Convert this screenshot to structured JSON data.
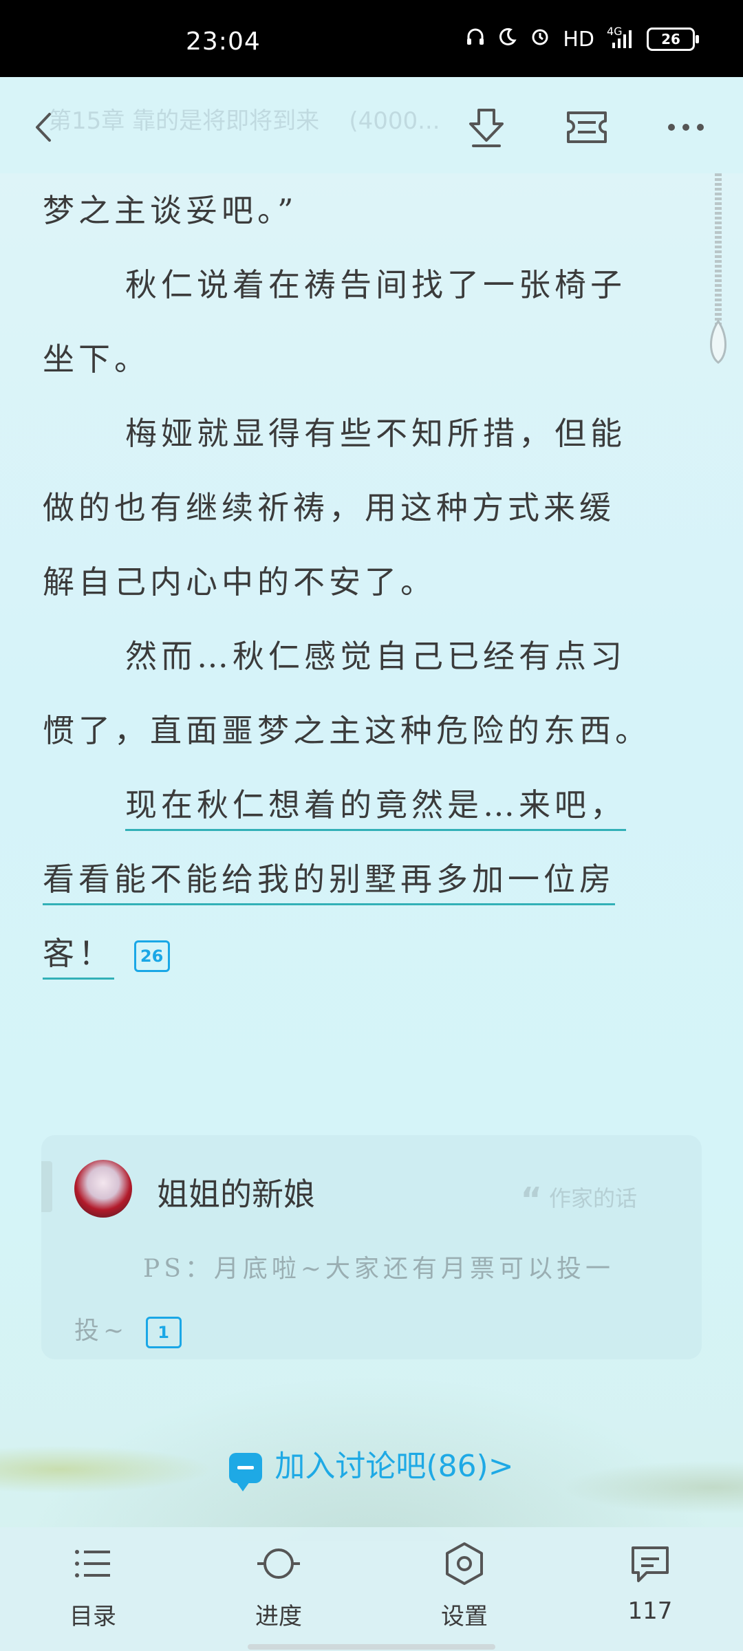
{
  "status_bar": {
    "time": "23:04",
    "network_label": "HD",
    "signal_label": "4G",
    "battery_level": "26",
    "icons": [
      "headphones-icon",
      "moon-icon",
      "alarm-icon",
      "signal-icon",
      "battery-icon"
    ]
  },
  "top_bar": {
    "chapter_title_faint": "第15章 靠的是将即将到来",
    "word_count_faint": "(4000...",
    "icons": [
      "back-icon",
      "download-icon",
      "ticket-icon",
      "more-icon"
    ]
  },
  "content": {
    "lines": [
      "梦之主谈妥吧。”",
      "秋仁说着在祷告间找了一张椅子",
      "坐下。",
      "梅娅就显得有些不知所措，但能",
      "做的也有继续祈祷，用这种方式来缓",
      "解自己内心中的不安了。",
      "然而…秋仁感觉自己已经有点习",
      "惯了，直面噩梦之主这种危险的东西。",
      "现在秋仁想着的竟然是…来吧，",
      "看看能不能给我的别墅再多加一位房",
      "客！"
    ],
    "paragraph_comment_count": "26"
  },
  "author_card": {
    "author_name": "姐姐的新娘",
    "tag_label": "作家的话",
    "message_line1": "PS：月底啦~大家还有月票可以投一",
    "message_line2": "投~",
    "comment_count": "1"
  },
  "discussion": {
    "label": "加入讨论吧(86)>"
  },
  "bottom_nav": {
    "items": [
      {
        "label": "目录",
        "icon": "list-icon"
      },
      {
        "label": "进度",
        "icon": "progress-icon"
      },
      {
        "label": "设置",
        "icon": "settings-icon"
      },
      {
        "label": "117",
        "icon": "comment-icon"
      }
    ]
  },
  "colors": {
    "background": "#d7f3f8",
    "accent_blue": "#1ea9e5",
    "underline_teal": "#32b0b7",
    "text": "#3b3b3b"
  }
}
